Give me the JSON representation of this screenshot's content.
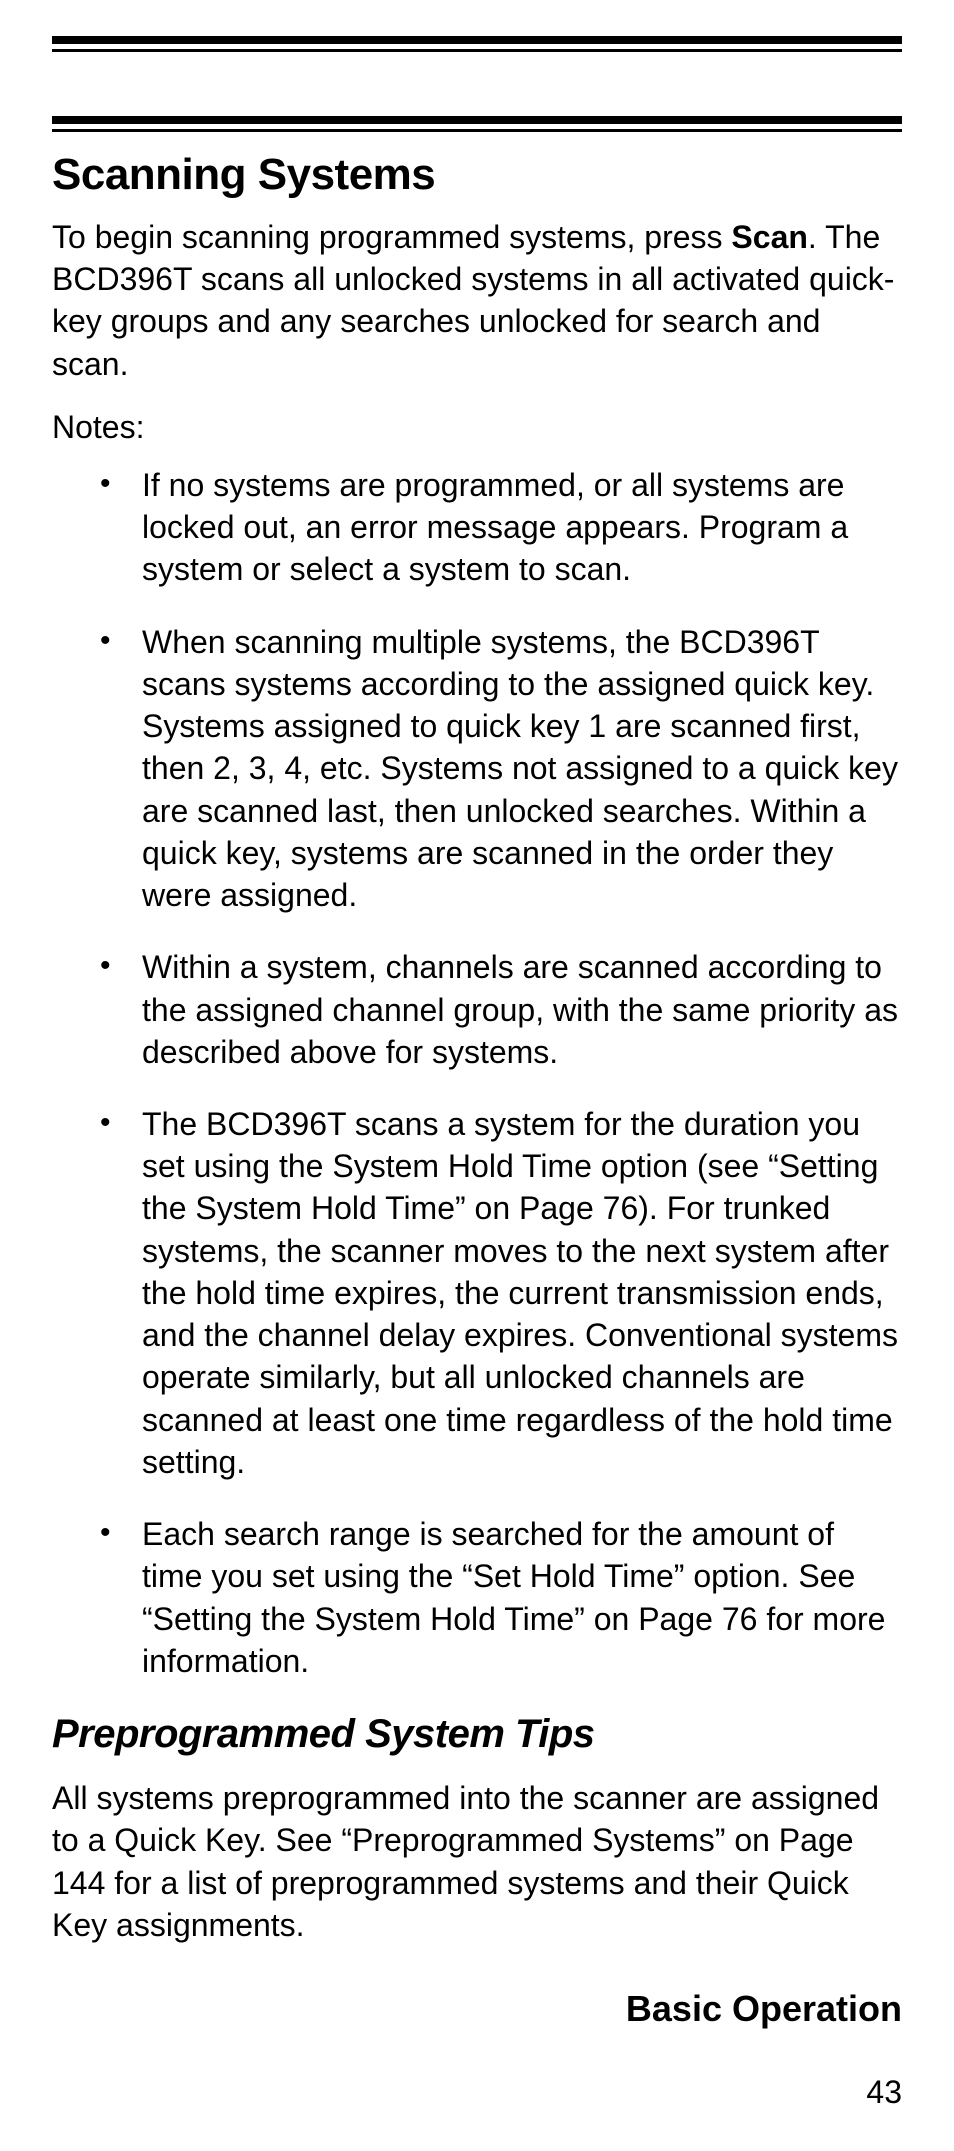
{
  "heading": "Scanning Systems",
  "intro_pre": "To begin scanning programmed systems, press ",
  "intro_bold": "Scan",
  "intro_post": ". The BCD396T scans all unlocked systems in all activated quick-key groups and any searches unlocked for search and scan.",
  "notes_label": "Notes:",
  "notes": [
    "If no systems are programmed, or all systems are locked out, an error message appears. Program a system or select a system to scan.",
    "When scanning multiple systems, the BCD396T scans systems according to the assigned quick key. Systems assigned to quick key 1 are scanned first, then 2, 3, 4, etc. Systems not assigned to a quick key are scanned last, then unlocked searches. Within a quick key, systems are scanned in the order they were assigned.",
    "Within a system, channels are scanned according to the assigned channel group, with the same priority as described above for systems.",
    "The BCD396T scans a system for the duration you set using the System Hold Time option (see “Setting the System Hold Time” on Page 76). For trunked systems, the scanner moves to the next system after the hold time expires, the current transmission ends, and the channel delay expires. Conventional systems operate similarly, but all unlocked channels are scanned at least one time regardless of the hold time setting.",
    "Each search range is searched for the amount of time you set using the “Set Hold Time” option. See “Setting the System Hold Time” on Page 76 for more information."
  ],
  "sub_heading": "Preprogrammed System Tips",
  "sub_body": "All systems preprogrammed into the scanner are assigned to a Quick Key. See “Preprogrammed Sys­tems” on Page 144 for a list of preprogrammed systems and their Quick Key assignments.",
  "footer_section": "Basic Operation",
  "page_number": "43"
}
